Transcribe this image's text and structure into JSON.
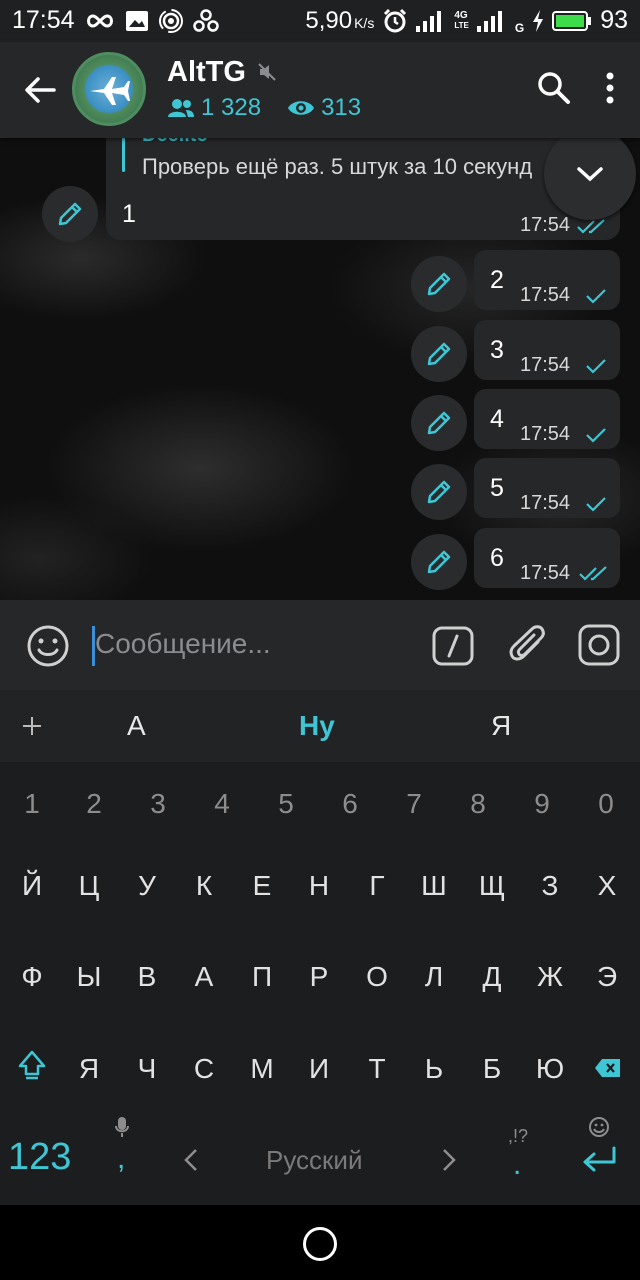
{
  "status_bar": {
    "time": "17:54",
    "speed": "5,90",
    "speed_unit": "K/s",
    "net1": "4G",
    "net1b": "LTE",
    "net2": "G",
    "battery": "93"
  },
  "header": {
    "title": "AltTG",
    "members": "1 328",
    "views": "313"
  },
  "messages": {
    "reply_author": "Deelite",
    "reply_text": "Проверь ещё раз. 5 штук за 10 секунд",
    "first_text": "1",
    "first_time": "17:54",
    "items": [
      {
        "text": "2",
        "time": "17:54"
      },
      {
        "text": "3",
        "time": "17:54"
      },
      {
        "text": "4",
        "time": "17:54"
      },
      {
        "text": "5",
        "time": "17:54"
      },
      {
        "text": "6",
        "time": "17:54"
      }
    ]
  },
  "input": {
    "placeholder": "Сообщение..."
  },
  "keyboard": {
    "suggestions": [
      "А",
      "Ну",
      "Я"
    ],
    "numbers": [
      "1",
      "2",
      "3",
      "4",
      "5",
      "6",
      "7",
      "8",
      "9",
      "0"
    ],
    "row1": [
      "Й",
      "Ц",
      "У",
      "К",
      "Е",
      "Н",
      "Г",
      "Ш",
      "Щ",
      "З",
      "Х"
    ],
    "row2": [
      "Ф",
      "Ы",
      "В",
      "А",
      "П",
      "Р",
      "О",
      "Л",
      "Д",
      "Ж",
      "Э"
    ],
    "row3": [
      "Я",
      "Ч",
      "С",
      "М",
      "И",
      "Т",
      "Ь",
      "Б",
      "Ю"
    ],
    "mode_key": "123",
    "comma": ",",
    "space_label": "Русский",
    "period": ".",
    "punct_hint": ",!?"
  },
  "colors": {
    "accent": "#3fc6d4"
  }
}
